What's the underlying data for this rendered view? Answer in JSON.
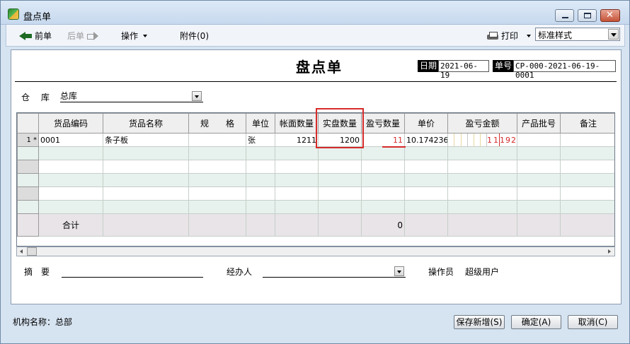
{
  "window": {
    "title": "盘点单"
  },
  "toolbar": {
    "prev_label": "前单",
    "next_label": "后单",
    "ops_label": "操作",
    "attach_label": "附件(0)",
    "print_label": "打印",
    "style_select_value": "标准样式"
  },
  "doc": {
    "title": "盘点单",
    "date_label": "日期",
    "date_value": "2021-06-19",
    "no_label": "单号",
    "no_value": "CP-000-2021-06-19-0001",
    "warehouse_label": "仓　 库",
    "warehouse_value": "总库",
    "summary_label": "摘　要",
    "summary_value": "",
    "handler_label": "经办人",
    "handler_value": "",
    "operator_label": "操作员",
    "operator_value": "超级用户"
  },
  "grid": {
    "columns": [
      "货品编码",
      "货品名称",
      "规　　格",
      "单位",
      "帐面数量",
      "实盘数量",
      "盈亏数量",
      "单价",
      "盈亏金额",
      "产品批号",
      "备注"
    ],
    "rows": [
      {
        "rownum": "1 *",
        "code": "0001",
        "name": "条子板",
        "spec": "",
        "unit": "张",
        "book_qty": "1211",
        "actual_qty": "1200",
        "diff_qty": "11",
        "price": "10.174236",
        "amount_digits": [
          "1",
          "1",
          "1",
          "9",
          "2"
        ],
        "batch": "",
        "remark": ""
      }
    ],
    "empty_rows": 5,
    "total_label": "合计",
    "total_diff_qty": "0"
  },
  "footer": {
    "org_text": "机构名称：总部",
    "save_new_label": "保存新增(S)",
    "ok_label": "确定(A)",
    "cancel_label": "取消(C)"
  },
  "colors": {
    "accent_red": "#d62a2a",
    "title_bar": "#d6e3f1"
  }
}
